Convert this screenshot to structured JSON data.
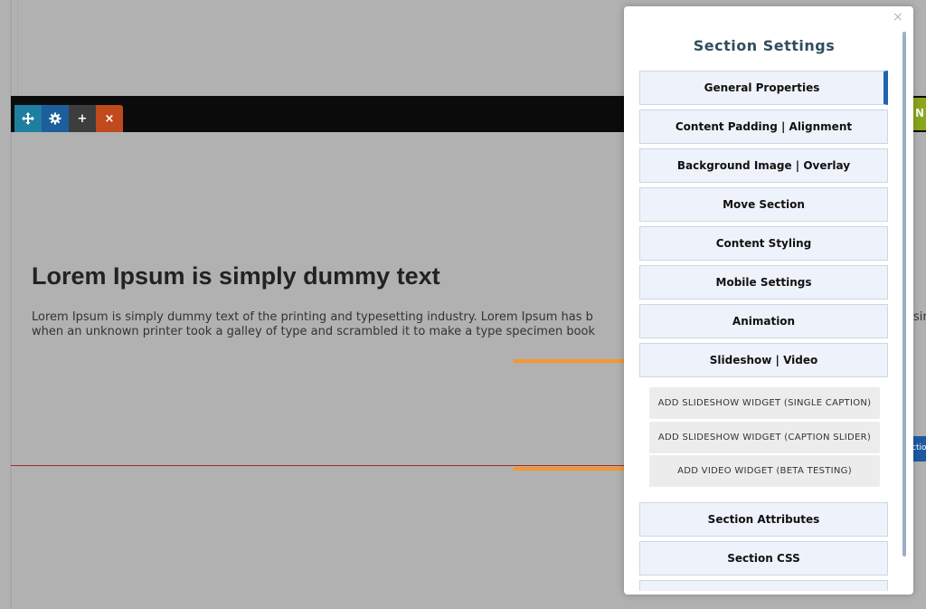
{
  "toolbar": {
    "move_icon": "move-arrows-icon",
    "settings_icon": "gear-icon",
    "add_label": "+",
    "close_label": "×"
  },
  "side_tabs": {
    "green_label": "N",
    "blue_label": "ctio"
  },
  "content": {
    "heading": "Lorem Ipsum is simply dummy text",
    "paragraph_line1": "Lorem Ipsum is simply dummy text of the printing and typesetting industry. Lorem Ipsum has b",
    "paragraph_line2": "when an unknown printer took a galley of type and scrambled it to make a type specimen book",
    "paragraph_overflow": "sin"
  },
  "modal": {
    "close_label": "×",
    "title": "Section Settings",
    "items": [
      {
        "label": "General Properties"
      },
      {
        "label": "Content Padding | Alignment"
      },
      {
        "label": "Background Image | Overlay"
      },
      {
        "label": "Move Section"
      },
      {
        "label": "Content Styling"
      },
      {
        "label": "Mobile Settings"
      },
      {
        "label": "Animation"
      },
      {
        "label": "Slideshow | Video"
      }
    ],
    "widgets": [
      {
        "label": "ADD SLIDESHOW WIDGET (SINGLE CAPTION)"
      },
      {
        "label": "ADD SLIDESHOW WIDGET (CAPTION SLIDER)"
      },
      {
        "label": "ADD VIDEO WIDGET (BETA TESTING)"
      }
    ],
    "items_after": [
      {
        "label": "Section Attributes"
      },
      {
        "label": "Section CSS"
      }
    ]
  },
  "colors": {
    "accent_blue": "#1f63b0",
    "arrow_orange": "#f5962e",
    "close_red": "#c04a1c",
    "backdrop": "#b1b1b1"
  }
}
